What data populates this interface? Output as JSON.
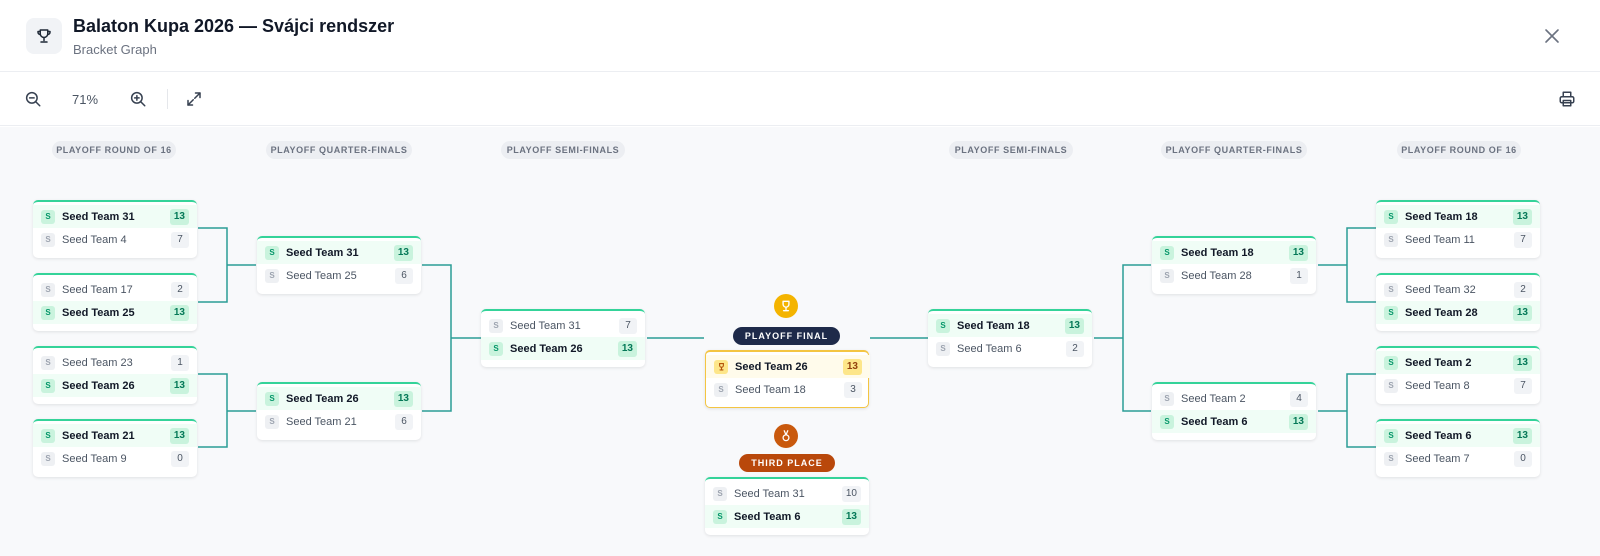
{
  "header": {
    "title": "Balaton Kupa 2026 — Svájci rendszer",
    "subtitle": "Bracket Graph"
  },
  "toolbar": {
    "zoom": "71%"
  },
  "icons": {
    "header": "trophy-icon",
    "close": "close-icon",
    "zoom_out": "zoom-out-icon",
    "zoom_in": "zoom-in-icon",
    "fullscreen": "expand-icon",
    "print": "printer-icon"
  },
  "colors": {
    "accent": "#34d399",
    "connector": "#2a9d96",
    "final_pill": "#1e2a4a",
    "third_pill": "#b9480b",
    "gold": "#f4b400"
  },
  "rounds": {
    "left_r16": "PLAYOFF ROUND OF 16",
    "left_qf": "PLAYOFF QUARTER-FINALS",
    "left_sf": "PLAYOFF SEMI-FINALS",
    "right_sf": "PLAYOFF SEMI-FINALS",
    "right_qf": "PLAYOFF QUARTER-FINALS",
    "right_r16": "PLAYOFF ROUND OF 16"
  },
  "labels": {
    "final": "PLAYOFF FINAL",
    "third_place": "THIRD PLACE",
    "seed_badge": "S"
  },
  "matches": {
    "l16_1": [
      {
        "name": "Seed Team 31",
        "score": "13",
        "win": true
      },
      {
        "name": "Seed Team 4",
        "score": "7",
        "win": false
      }
    ],
    "l16_2": [
      {
        "name": "Seed Team 17",
        "score": "2",
        "win": false
      },
      {
        "name": "Seed Team 25",
        "score": "13",
        "win": true
      }
    ],
    "l16_3": [
      {
        "name": "Seed Team 23",
        "score": "1",
        "win": false
      },
      {
        "name": "Seed Team 26",
        "score": "13",
        "win": true
      }
    ],
    "l16_4": [
      {
        "name": "Seed Team 21",
        "score": "13",
        "win": true
      },
      {
        "name": "Seed Team 9",
        "score": "0",
        "win": false
      }
    ],
    "lqf_1": [
      {
        "name": "Seed Team 31",
        "score": "13",
        "win": true
      },
      {
        "name": "Seed Team 25",
        "score": "6",
        "win": false
      }
    ],
    "lqf_2": [
      {
        "name": "Seed Team 26",
        "score": "13",
        "win": true
      },
      {
        "name": "Seed Team 21",
        "score": "6",
        "win": false
      }
    ],
    "lsf": [
      {
        "name": "Seed Team 31",
        "score": "7",
        "win": false
      },
      {
        "name": "Seed Team 26",
        "score": "13",
        "win": true
      }
    ],
    "final": [
      {
        "name": "Seed Team 26",
        "score": "13",
        "win": true
      },
      {
        "name": "Seed Team 18",
        "score": "3",
        "win": false
      }
    ],
    "third": [
      {
        "name": "Seed Team 31",
        "score": "10",
        "win": false
      },
      {
        "name": "Seed Team 6",
        "score": "13",
        "win": true
      }
    ],
    "rsf": [
      {
        "name": "Seed Team 18",
        "score": "13",
        "win": true
      },
      {
        "name": "Seed Team 6",
        "score": "2",
        "win": false
      }
    ],
    "rqf_1": [
      {
        "name": "Seed Team 18",
        "score": "13",
        "win": true
      },
      {
        "name": "Seed Team 28",
        "score": "1",
        "win": false
      }
    ],
    "rqf_2": [
      {
        "name": "Seed Team 2",
        "score": "4",
        "win": false
      },
      {
        "name": "Seed Team 6",
        "score": "13",
        "win": true
      }
    ],
    "r16_1": [
      {
        "name": "Seed Team 18",
        "score": "13",
        "win": true
      },
      {
        "name": "Seed Team 11",
        "score": "7",
        "win": false
      }
    ],
    "r16_2": [
      {
        "name": "Seed Team 32",
        "score": "2",
        "win": false
      },
      {
        "name": "Seed Team 28",
        "score": "13",
        "win": true
      }
    ],
    "r16_3": [
      {
        "name": "Seed Team 2",
        "score": "13",
        "win": true
      },
      {
        "name": "Seed Team 8",
        "score": "7",
        "win": false
      }
    ],
    "r16_4": [
      {
        "name": "Seed Team 6",
        "score": "13",
        "win": true
      },
      {
        "name": "Seed Team 7",
        "score": "0",
        "win": false
      }
    ]
  }
}
